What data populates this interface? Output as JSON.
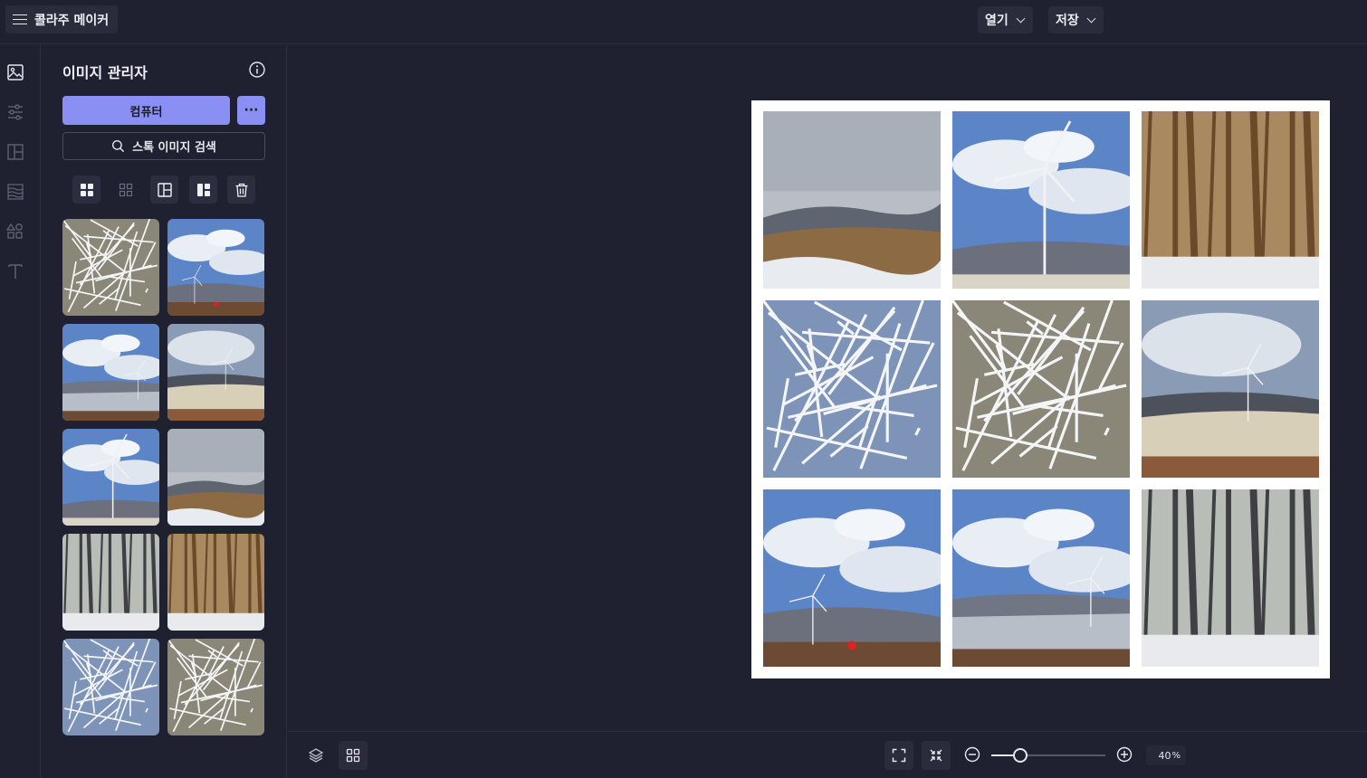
{
  "app": {
    "title": "콜라주 메이커"
  },
  "topbar": {
    "open_label": "열기",
    "save_label": "저장"
  },
  "rail": {
    "items": [
      "image-icon",
      "sliders-icon",
      "layout-icon",
      "background-icon",
      "shapes-icon",
      "text-icon"
    ]
  },
  "panel": {
    "title": "이미지 관리자",
    "computer_label": "컴퓨터",
    "more_label": "···",
    "stock_label": "스톡 이미지 검색"
  },
  "thumbnails": [
    "frost-branches",
    "wind-turbine-hiker",
    "snowy-ridge-turbine",
    "turbine-hill-field",
    "tall-wind-turbine",
    "misty-ridge-grass",
    "snowy-forest-path",
    "larch-forest-snow",
    "frosted-trees-blue-sky",
    "frost-branches-close"
  ],
  "collage": {
    "cells": [
      "misty-ridge-grass",
      "tall-wind-turbine",
      "larch-forest-snow",
      "frosted-trees-blue-sky",
      "frost-branches",
      "turbine-hill-field",
      "wind-turbine-hiker",
      "snowy-ridge-turbine",
      "snowy-forest-path"
    ]
  },
  "zoom": {
    "value": "40",
    "unit": "%",
    "slider_fraction": 0.25
  },
  "colors": {
    "accent": "#8a90f3",
    "background": "#1f2030",
    "panel_button": "#2a2b3b"
  }
}
